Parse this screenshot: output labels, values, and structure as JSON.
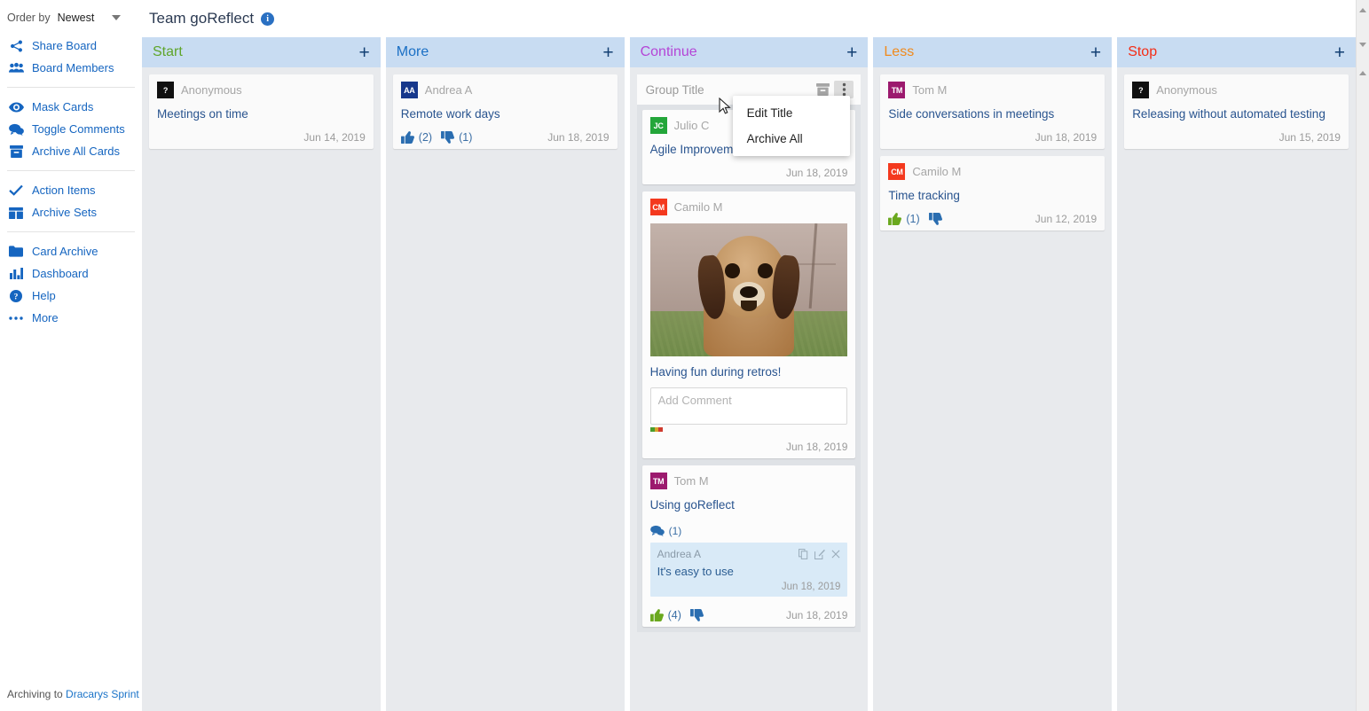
{
  "sidebar": {
    "order_by": {
      "label": "Order by",
      "value": "Newest"
    },
    "groups": [
      {
        "items": [
          {
            "label": "Share Board",
            "icon": "share-icon"
          },
          {
            "label": "Board Members",
            "icon": "people-icon"
          }
        ]
      },
      {
        "items": [
          {
            "label": "Mask Cards",
            "icon": "eye-icon"
          },
          {
            "label": "Toggle Comments",
            "icon": "comments-icon"
          },
          {
            "label": "Archive All Cards",
            "icon": "archive-box-icon"
          }
        ]
      },
      {
        "items": [
          {
            "label": "Action Items",
            "icon": "check-icon"
          },
          {
            "label": "Archive Sets",
            "icon": "archive-sets-icon"
          }
        ]
      },
      {
        "items": [
          {
            "label": "Card Archive",
            "icon": "folder-icon"
          },
          {
            "label": "Dashboard",
            "icon": "bar-chart-icon"
          },
          {
            "label": "Help",
            "icon": "question-circle-icon"
          },
          {
            "label": "More",
            "icon": "ellipsis-icon"
          }
        ]
      }
    ],
    "footer": {
      "prefix": "Archiving to ",
      "link": "Dracarys Sprint"
    }
  },
  "header": {
    "title": "Team goReflect",
    "info_icon": "info-icon"
  },
  "group_menu": {
    "title": "Group Title",
    "archive_icon": "archive-box-icon",
    "more_icon": "vertical-ellipsis-icon",
    "items": [
      {
        "label": "Edit Title"
      },
      {
        "label": "Archive All"
      }
    ]
  },
  "columns": [
    {
      "name": "Start",
      "color": "#5fa52a",
      "add_label": "+",
      "cards": [
        {
          "author": "Anonymous",
          "initials": "?",
          "avatar_color": "#111111",
          "text": "Meetings on time",
          "date": "Jun 14, 2019",
          "votes": null
        }
      ]
    },
    {
      "name": "More",
      "color": "#1a6fc4",
      "add_label": "+",
      "cards": [
        {
          "author": "Andrea A",
          "initials": "AA",
          "avatar_color": "#17388c",
          "text": "Remote work days",
          "date": "Jun 18, 2019",
          "votes": {
            "up": "(2)",
            "down": "(1)",
            "up_active": false,
            "down_active": false
          }
        }
      ]
    },
    {
      "name": "Continue",
      "color": "#b445d6",
      "add_label": "+",
      "grouped": true,
      "cards": [
        {
          "author": "Julio C",
          "initials": "JC",
          "avatar_color": "#24a63a",
          "text": "Agile Improvement",
          "date": "Jun 18, 2019",
          "votes": null
        },
        {
          "author": "Camilo M",
          "initials": "CM",
          "avatar_color": "#f4391e",
          "image": "dog-photo",
          "text": "Having fun during retros!",
          "comment_placeholder": "Add Comment",
          "comment_value": "",
          "date": "Jun 18, 2019",
          "votes": null
        },
        {
          "author": "Tom M",
          "initials": "TM",
          "avatar_color": "#9c1a6e",
          "text": "Using goReflect",
          "comment_count": "(1)",
          "comments": [
            {
              "author": "Andrea A",
              "text": "It's easy to use",
              "date": "Jun 18, 2019",
              "actions": [
                "copy-icon",
                "edit-icon",
                "close-icon"
              ]
            }
          ],
          "date": "Jun 18, 2019",
          "votes": {
            "up": "(4)",
            "down": "",
            "up_active": true,
            "down_active": false
          }
        }
      ]
    },
    {
      "name": "Less",
      "color": "#f08a1d",
      "add_label": "+",
      "cards": [
        {
          "author": "Tom M",
          "initials": "TM",
          "avatar_color": "#9c1a6e",
          "text": "Side conversations in meetings",
          "date": "Jun 18, 2019",
          "votes": null
        },
        {
          "author": "Camilo M",
          "initials": "CM",
          "avatar_color": "#f4391e",
          "text": "Time tracking",
          "date": "Jun 12, 2019",
          "votes": {
            "up": "(1)",
            "down": "",
            "up_active": true,
            "down_active": false
          }
        }
      ]
    },
    {
      "name": "Stop",
      "color": "#f42d16",
      "add_label": "+",
      "cards": [
        {
          "author": "Anonymous",
          "initials": "?",
          "avatar_color": "#111111",
          "text": "Releasing without automated testing",
          "date": "Jun 15, 2019",
          "votes": null
        }
      ]
    }
  ]
}
